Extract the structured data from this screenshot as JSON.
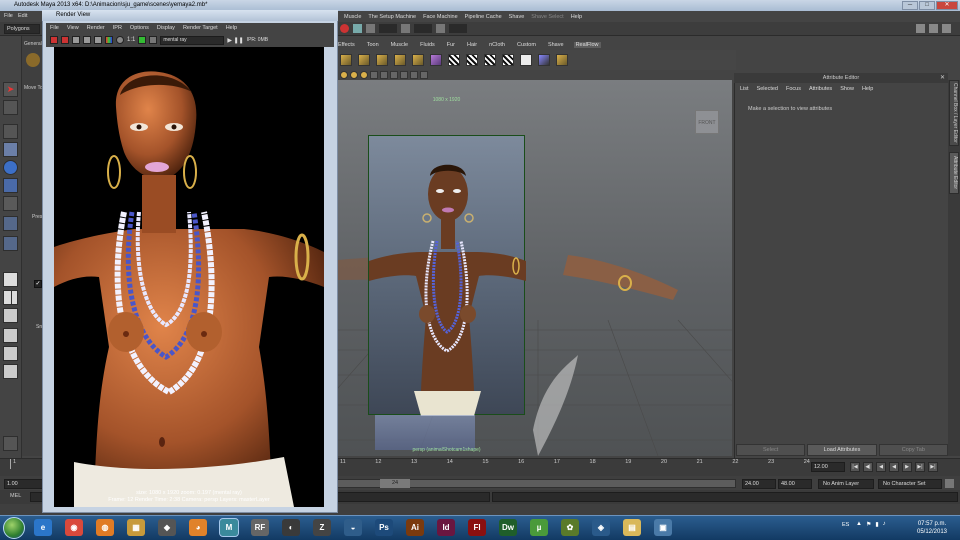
{
  "window": {
    "title": "Autodesk Maya 2013 x64: D:\\Animacion\\sju_game\\scenes\\yemaya2.mb*",
    "min": "─",
    "max": "□",
    "close": "✕"
  },
  "menubar": {
    "items": [
      "File",
      "Edit",
      "Modify",
      "Create",
      "Display",
      "Window",
      "Assets",
      "Select",
      "Mesh",
      "Edit Mesh",
      "Proxy",
      "Normals",
      "Color",
      "Create UVs",
      "Edit UVs",
      "Help",
      "nCloth",
      "Fluid Effects",
      "Fluid nCache",
      "Fields",
      "Soft/Rigid Bodies",
      "Effects",
      "Solvers",
      "Hair",
      "Muscle",
      "The Setup Machine",
      "Face Machine",
      "Pipeline Cache",
      "Shave",
      "Shave Select",
      "Help"
    ],
    "visible_right": [
      "Muscle",
      "The Setup Machine",
      "Face Machine",
      "Pipeline Cache",
      "Shave"
    ],
    "dim_right": "Shave Select",
    "help": "Help"
  },
  "status_line": {
    "mode": "Polygons"
  },
  "shelf_tabs": [
    "Effects",
    "Toon",
    "Muscle",
    "Fluids",
    "Fur",
    "Hair",
    "nCloth",
    "Custom",
    "Shave",
    "RealFlow"
  ],
  "toolbox": {
    "general_tab": "General",
    "move_tool": "Move To",
    "presets": "Prese",
    "snap": "Sn"
  },
  "viewport": {
    "resolution_label": "1080 x 1920",
    "camera_label": "persp (animalShotcam1shape)",
    "viewcube": "FRONT"
  },
  "attribute_editor": {
    "title": "Attribute Editor",
    "menu": [
      "List",
      "Selected",
      "Focus",
      "Attributes",
      "Show",
      "Help"
    ],
    "message": "Make a selection to view attributes",
    "buttons": {
      "select": "Select",
      "load": "Load Attributes",
      "copy": "Copy Tab"
    },
    "side_tabs": [
      "Channel Box / Layer Editor",
      "Attribute Editor"
    ]
  },
  "time_slider": {
    "ticks": [
      "11",
      "12",
      "13",
      "14",
      "15",
      "16",
      "17",
      "18",
      "19",
      "20",
      "21",
      "22",
      "23",
      "24"
    ],
    "current_frame": "12.00",
    "playback_buttons": [
      "|◀",
      "◀|",
      "◀",
      "◀",
      "▶",
      "▶|",
      "▶|"
    ]
  },
  "range_slider": {
    "start": "1.00",
    "handle": "24",
    "end_anim": "24.00",
    "end_range": "48.00",
    "anim_layer": "No Anim Layer",
    "char_set": "No Character Set"
  },
  "command_line": {
    "label": "MEL"
  },
  "render_view": {
    "title": "Render View",
    "menu": [
      "File",
      "View",
      "Render",
      "IPR",
      "Options",
      "Display",
      "Render Target",
      "Help"
    ],
    "camera": "mental ray",
    "ipr_label": "IPR: 0MB",
    "ratio": "1:1",
    "info_size": "size: 1080 x 1920  zoom: 0.197    (mental ray)",
    "info_frame": "Frame: 12    Render Time: 2:38    Camera: persp    Layers: masterLayer"
  },
  "taskbar": {
    "apps": [
      {
        "name": "ie",
        "label": "e",
        "color": "#2b76c9"
      },
      {
        "name": "chrome",
        "label": "◉",
        "color": "#d9493c"
      },
      {
        "name": "firefox",
        "label": "◍",
        "color": "#e07b25"
      },
      {
        "name": "explorer",
        "label": "▦",
        "color": "#c79a3b"
      },
      {
        "name": "unity",
        "label": "◆",
        "color": "#555"
      },
      {
        "name": "blender",
        "label": "◕",
        "color": "#e0822a"
      },
      {
        "name": "maya",
        "label": "M",
        "color": "#3a8a9c"
      },
      {
        "name": "realflow",
        "label": "RF",
        "color": "#666"
      },
      {
        "name": "misc1",
        "label": "◐",
        "color": "#3a3a3a"
      },
      {
        "name": "zbrush",
        "label": "Z",
        "color": "#444"
      },
      {
        "name": "misc2",
        "label": "◒",
        "color": "#2f5d8a"
      },
      {
        "name": "photoshop",
        "label": "Ps",
        "color": "#1d4a7a"
      },
      {
        "name": "illustrator",
        "label": "Ai",
        "color": "#7a3a0e"
      },
      {
        "name": "indesign",
        "label": "Id",
        "color": "#6a1640"
      },
      {
        "name": "flash",
        "label": "Fl",
        "color": "#8a1010"
      },
      {
        "name": "dreamweaver",
        "label": "Dw",
        "color": "#1f5e2a"
      },
      {
        "name": "utorrent",
        "label": "µ",
        "color": "#4a9a3a"
      },
      {
        "name": "misc3",
        "label": "✿",
        "color": "#5a7a2a"
      },
      {
        "name": "misc4",
        "label": "◈",
        "color": "#2a5a8a"
      },
      {
        "name": "folder",
        "label": "▤",
        "color": "#d9b85a"
      },
      {
        "name": "misc5",
        "label": "▣",
        "color": "#4a7aa8"
      }
    ],
    "tray_lang": "ES",
    "time": "07:57 p.m.",
    "date": "05/12/2013"
  }
}
